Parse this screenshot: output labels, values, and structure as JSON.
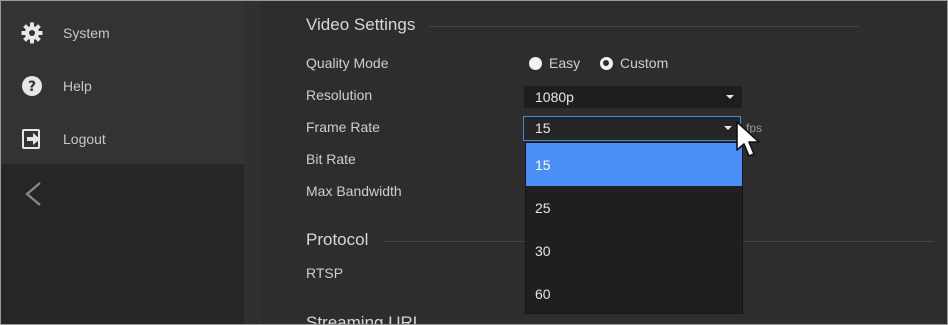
{
  "sidebar": {
    "items": [
      {
        "label": "System",
        "icon": "gear-icon"
      },
      {
        "label": "Help",
        "icon": "help-icon"
      },
      {
        "label": "Logout",
        "icon": "logout-icon"
      }
    ],
    "collapse_icon": "chevron-left-icon"
  },
  "main": {
    "video_settings": {
      "title": "Video Settings",
      "quality_mode": {
        "label": "Quality Mode",
        "options": [
          {
            "label": "Easy",
            "selected": false
          },
          {
            "label": "Custom",
            "selected": true
          }
        ]
      },
      "resolution": {
        "label": "Resolution",
        "value": "1080p"
      },
      "frame_rate": {
        "label": "Frame Rate",
        "value": "15",
        "unit": "fps",
        "options": [
          "15",
          "25",
          "30",
          "60"
        ],
        "highlighted": "15"
      },
      "bit_rate": {
        "label": "Bit Rate"
      },
      "max_bandwidth": {
        "label": "Max Bandwidth"
      }
    },
    "protocol": {
      "title": "Protocol",
      "rtsp_label": "RTSP"
    },
    "streaming_url": {
      "title": "Streaming URL"
    }
  },
  "colors": {
    "accent": "#4a8ff5",
    "focus_border": "#3b8fd9",
    "background": "#2d2d2d",
    "sidebar": "#333333"
  }
}
